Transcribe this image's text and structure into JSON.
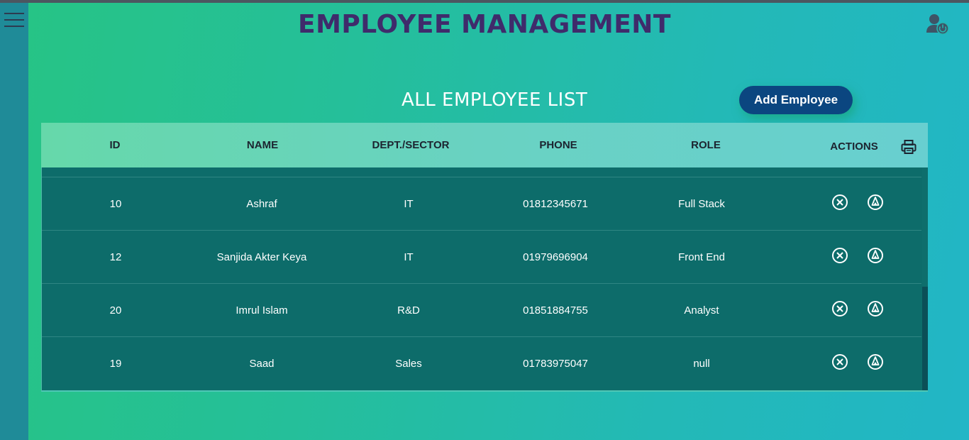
{
  "header": {
    "title": "EMPLOYEE MANAGEMENT",
    "user_icon": "user-logout-icon",
    "menu_icon": "hamburger-menu-icon"
  },
  "main": {
    "list_title": "ALL EMPLOYEE LIST",
    "add_button_label": "Add Employee"
  },
  "table": {
    "columns": [
      "ID",
      "NAME",
      "DEPT./SECTOR",
      "PHONE",
      "ROLE",
      "ACTIONS"
    ],
    "print_icon": "printer-icon",
    "rows": [
      {
        "id": "10",
        "name": "Ashraf",
        "dept": "IT",
        "phone": "01812345671",
        "role": "Full Stack"
      },
      {
        "id": "12",
        "name": "Sanjida Akter Keya",
        "dept": "IT",
        "phone": "01979696904",
        "role": "Front End"
      },
      {
        "id": "20",
        "name": "Imrul Islam",
        "dept": "R&D",
        "phone": "01851884755",
        "role": "Analyst"
      },
      {
        "id": "19",
        "name": "Saad",
        "dept": "Sales",
        "phone": "01783975047",
        "role": "null"
      }
    ],
    "action_icons": [
      "delete-circle-x-icon",
      "edit-pen-circle-icon"
    ]
  },
  "colors": {
    "title": "#3f2b6b",
    "button": "#0b4680",
    "table_body": "#0d6c6a",
    "header_gradient_start": "#66d8aa",
    "sidebar": "#1f8b98"
  }
}
